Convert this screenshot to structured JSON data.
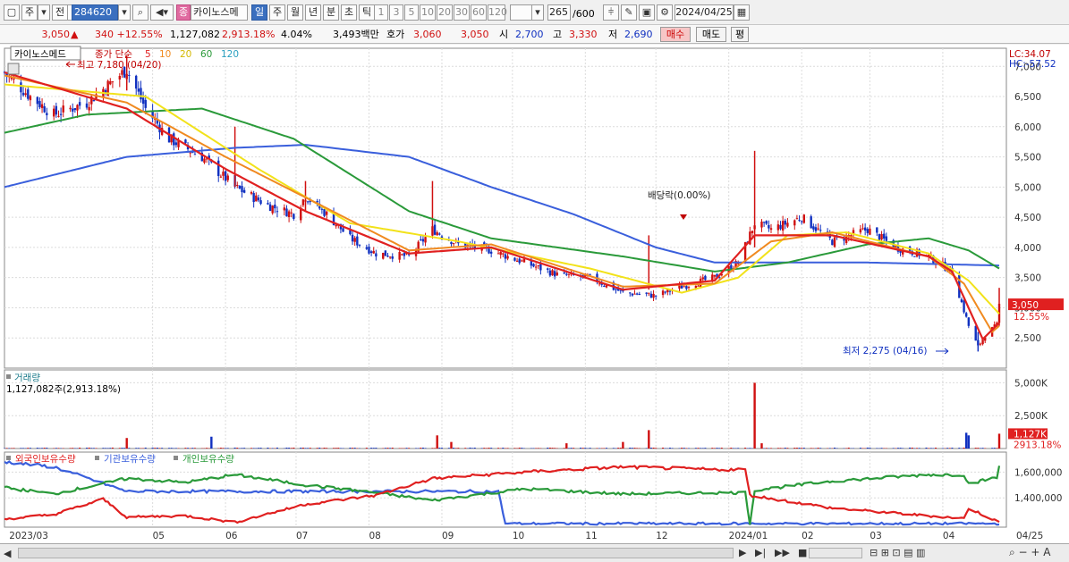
{
  "toolbar": {
    "period_label": "주",
    "prev_label": "전",
    "code": "284620",
    "stock_name": "카이노스메",
    "jong_label": "종",
    "period_tabs": [
      "일",
      "주",
      "월",
      "년",
      "분",
      "초",
      "틱"
    ],
    "active_tab": "일",
    "minute_options": [
      "1",
      "3",
      "5",
      "10",
      "20",
      "30",
      "60",
      "120"
    ],
    "count": "265",
    "count_total": "/600",
    "date": "2024/04/25"
  },
  "quote": {
    "price": "3,050",
    "change": "340 +12.55%",
    "volume": "1,127,082",
    "volume_ratio": "2,913.18%",
    "turnover": "4.04%",
    "amount": "3,493백만",
    "ask_label": "호가",
    "ask1": "3,060",
    "ask2": "3,050",
    "open_label": "시",
    "open": "2,700",
    "high_label": "고",
    "high": "3,330",
    "low_label": "저",
    "low": "2,690",
    "buy_label": "매수",
    "sell_label": "매도",
    "eval_label": "평"
  },
  "colors": {
    "up": "#d01010",
    "down": "#1030c0",
    "ma5": "#e02020",
    "ma10": "#f08a20",
    "ma20": "#f2e21a",
    "ma60": "#2a9a3a",
    "ma120": "#3a5fdc",
    "foreign": "#e02020",
    "institution": "#3a5fdc",
    "individual": "#2a9a3a"
  },
  "chart_data": [
    {
      "type": "candlestick",
      "title": "카이노스메드",
      "legend": {
        "prefix": "종가 단순",
        "periods": [
          "5",
          "10",
          "20",
          "60",
          "120"
        ]
      },
      "ylim": [
        2000,
        7300
      ],
      "yticks": [
        2500,
        3000,
        3500,
        4000,
        4500,
        5000,
        5500,
        6000,
        6500,
        7000
      ],
      "ytick_labels": [
        "2,500",
        "3,000",
        "3,500",
        "4,000",
        "4,500",
        "5,000",
        "5,500",
        "6,000",
        "6,500",
        "7,000"
      ],
      "x_labels": [
        "2023/03",
        "05",
        "06",
        "07",
        "08",
        "09",
        "10",
        "11",
        "12",
        "2024/01",
        "02",
        "03",
        "04",
        "04/25"
      ],
      "x_label_months": [
        "2023-03-01",
        "2023-05-01",
        "2023-06-01",
        "2023-07-01",
        "2023-08-01",
        "2023-09-01",
        "2023-10-01",
        "2023-11-01",
        "2023-12-01",
        "2024-01-01",
        "2024-02-01",
        "2024-03-01",
        "2024-04-01",
        "2024-04-25"
      ],
      "high_annotation": "최고 7,180 (04/20)",
      "low_annotation": "최저 2,275 (04/16)",
      "dividend_annotation": "배당락(0.00%)",
      "lc_label": "LC:34.07",
      "hc_label": "HC:-57.52",
      "current_price": "3,050",
      "current_change": "12.55%",
      "close_keypoints": [
        [
          "2023-02-27",
          6900
        ],
        [
          "2023-03-10",
          6500
        ],
        [
          "2023-03-20",
          6200
        ],
        [
          "2023-04-03",
          6400
        ],
        [
          "2023-04-20",
          6950
        ],
        [
          "2023-04-28",
          6300
        ],
        [
          "2023-05-08",
          5800
        ],
        [
          "2023-05-22",
          5500
        ],
        [
          "2023-06-05",
          5000
        ],
        [
          "2023-06-19",
          4700
        ],
        [
          "2023-06-30",
          4550
        ],
        [
          "2023-07-05",
          4850
        ],
        [
          "2023-07-14",
          4550
        ],
        [
          "2023-07-24",
          4150
        ],
        [
          "2023-08-04",
          3900
        ],
        [
          "2023-08-18",
          3850
        ],
        [
          "2023-08-28",
          4300
        ],
        [
          "2023-09-08",
          4050
        ],
        [
          "2023-09-22",
          3950
        ],
        [
          "2023-10-06",
          3750
        ],
        [
          "2023-10-20",
          3550
        ],
        [
          "2023-11-03",
          3500
        ],
        [
          "2023-11-17",
          3250
        ],
        [
          "2023-12-01",
          3200
        ],
        [
          "2023-12-12",
          3350
        ],
        [
          "2023-12-26",
          3500
        ],
        [
          "2024-01-05",
          3750
        ],
        [
          "2024-01-12",
          4400
        ],
        [
          "2024-01-19",
          4300
        ],
        [
          "2024-02-01",
          4500
        ],
        [
          "2024-02-14",
          4100
        ],
        [
          "2024-02-29",
          4300
        ],
        [
          "2024-03-12",
          4000
        ],
        [
          "2024-03-26",
          3850
        ],
        [
          "2024-04-05",
          3600
        ],
        [
          "2024-04-12",
          2700
        ],
        [
          "2024-04-16",
          2350
        ],
        [
          "2024-04-19",
          2550
        ],
        [
          "2024-04-24",
          2710
        ],
        [
          "2024-04-25",
          3050
        ]
      ],
      "ma_keypoints": {
        "ma5": [
          [
            "2023-02-27",
            6900
          ],
          [
            "2023-04-20",
            6300
          ],
          [
            "2023-06-01",
            5300
          ],
          [
            "2023-07-05",
            4600
          ],
          [
            "2023-08-18",
            3900
          ],
          [
            "2023-09-22",
            4000
          ],
          [
            "2023-11-17",
            3300
          ],
          [
            "2023-12-26",
            3450
          ],
          [
            "2024-01-12",
            4200
          ],
          [
            "2024-02-14",
            4200
          ],
          [
            "2024-03-26",
            3850
          ],
          [
            "2024-04-05",
            3600
          ],
          [
            "2024-04-18",
            2480
          ],
          [
            "2024-04-25",
            2750
          ]
        ],
        "ma10": [
          [
            "2023-02-27",
            6850
          ],
          [
            "2023-04-20",
            6400
          ],
          [
            "2023-06-01",
            5500
          ],
          [
            "2023-07-14",
            4650
          ],
          [
            "2023-08-18",
            3950
          ],
          [
            "2023-09-22",
            4050
          ],
          [
            "2023-11-17",
            3350
          ],
          [
            "2023-12-26",
            3400
          ],
          [
            "2024-01-19",
            4100
          ],
          [
            "2024-02-14",
            4250
          ],
          [
            "2024-03-26",
            3850
          ],
          [
            "2024-04-10",
            3400
          ],
          [
            "2024-04-22",
            2600
          ],
          [
            "2024-04-25",
            2700
          ]
        ],
        "ma20": [
          [
            "2023-02-27",
            6700
          ],
          [
            "2023-04-28",
            6500
          ],
          [
            "2023-06-15",
            5300
          ],
          [
            "2023-07-24",
            4400
          ],
          [
            "2023-09-08",
            4100
          ],
          [
            "2023-11-03",
            3650
          ],
          [
            "2023-12-12",
            3250
          ],
          [
            "2024-01-05",
            3500
          ],
          [
            "2024-01-26",
            4200
          ],
          [
            "2024-02-20",
            4250
          ],
          [
            "2024-03-26",
            3900
          ],
          [
            "2024-04-12",
            3450
          ],
          [
            "2024-04-25",
            2900
          ]
        ],
        "ma60": [
          [
            "2023-02-27",
            5900
          ],
          [
            "2023-04-03",
            6200
          ],
          [
            "2023-05-22",
            6300
          ],
          [
            "2023-06-30",
            5800
          ],
          [
            "2023-08-18",
            4600
          ],
          [
            "2023-09-22",
            4150
          ],
          [
            "2023-11-17",
            3850
          ],
          [
            "2023-12-26",
            3600
          ],
          [
            "2024-01-26",
            3750
          ],
          [
            "2024-02-29",
            4050
          ],
          [
            "2024-03-26",
            4150
          ],
          [
            "2024-04-12",
            3950
          ],
          [
            "2024-04-25",
            3650
          ]
        ],
        "ma120": [
          [
            "2023-02-27",
            5000
          ],
          [
            "2023-04-20",
            5500
          ],
          [
            "2023-06-05",
            5650
          ],
          [
            "2023-07-05",
            5700
          ],
          [
            "2023-08-18",
            5500
          ],
          [
            "2023-09-22",
            5000
          ],
          [
            "2023-10-27",
            4550
          ],
          [
            "2023-12-01",
            4000
          ],
          [
            "2023-12-26",
            3750
          ],
          [
            "2024-01-26",
            3750
          ],
          [
            "2024-02-29",
            3750
          ],
          [
            "2024-04-25",
            3700
          ]
        ]
      }
    },
    {
      "type": "bar",
      "title": "거래량",
      "subtitle": "1,127,082주(2,913.18%)",
      "ylim": [
        0,
        5300
      ],
      "units": "K",
      "yticks": [
        2500,
        5000
      ],
      "ytick_labels": [
        "2,500K",
        "5,000K"
      ],
      "current_label": "1,127K",
      "current_ratio": "2913.18%",
      "base_volume_k": 40,
      "spikes": [
        [
          "2023-04-20",
          800,
          "up"
        ],
        [
          "2023-05-26",
          900,
          "down"
        ],
        [
          "2023-08-30",
          1000,
          "up"
        ],
        [
          "2023-09-05",
          500,
          "up"
        ],
        [
          "2023-10-24",
          400,
          "up"
        ],
        [
          "2023-11-17",
          500,
          "up"
        ],
        [
          "2023-11-28",
          1400,
          "up"
        ],
        [
          "2024-01-12",
          5000,
          "up"
        ],
        [
          "2024-01-15",
          400,
          "up"
        ],
        [
          "2024-04-11",
          1200,
          "down"
        ],
        [
          "2024-04-12",
          1000,
          "down"
        ],
        [
          "2024-04-25",
          1127,
          "up"
        ]
      ]
    },
    {
      "type": "line",
      "series_labels": [
        "외국인보유수량",
        "기관보유수량",
        "개인보유수량"
      ],
      "ylim": [
        1200000,
        1700000
      ],
      "yticks": [
        1400000,
        1600000
      ],
      "ytick_labels": [
        "1,400,000",
        "1,600,000"
      ],
      "foreign_keypoints": [
        [
          "2023-02-27",
          1235000
        ],
        [
          "2023-03-20",
          1270000
        ],
        [
          "2023-04-10",
          1390000
        ],
        [
          "2023-04-20",
          1250000
        ],
        [
          "2023-05-15",
          1260000
        ],
        [
          "2023-06-05",
          1210000
        ],
        [
          "2023-07-05",
          1350000
        ],
        [
          "2023-08-04",
          1420000
        ],
        [
          "2023-08-28",
          1550000
        ],
        [
          "2023-10-06",
          1600000
        ],
        [
          "2023-11-17",
          1640000
        ],
        [
          "2023-12-26",
          1620000
        ],
        [
          "2024-01-08",
          1620000
        ],
        [
          "2024-01-10",
          1420000
        ],
        [
          "2024-02-14",
          1320000
        ],
        [
          "2024-03-26",
          1260000
        ],
        [
          "2024-04-10",
          1240000
        ],
        [
          "2024-04-12",
          1320000
        ],
        [
          "2024-04-25",
          1210000
        ]
      ],
      "institution_keypoints": [
        [
          "2023-02-27",
          1680000
        ],
        [
          "2023-03-20",
          1640000
        ],
        [
          "2023-04-20",
          1450000
        ],
        [
          "2023-05-15",
          1450000
        ],
        [
          "2023-09-25",
          1450000
        ],
        [
          "2023-09-28",
          1200000
        ],
        [
          "2024-04-25",
          1200000
        ]
      ],
      "individual_keypoints": [
        [
          "2023-02-27",
          1480000
        ],
        [
          "2023-03-20",
          1430000
        ],
        [
          "2023-04-20",
          1550000
        ],
        [
          "2023-05-15",
          1520000
        ],
        [
          "2023-06-05",
          1580000
        ],
        [
          "2023-07-05",
          1500000
        ],
        [
          "2023-08-04",
          1440000
        ],
        [
          "2023-08-28",
          1380000
        ],
        [
          "2023-10-06",
          1470000
        ],
        [
          "2023-11-17",
          1430000
        ],
        [
          "2023-12-26",
          1440000
        ],
        [
          "2024-01-08",
          1440000
        ],
        [
          "2024-01-10",
          1200000
        ],
        [
          "2024-01-12",
          1460000
        ],
        [
          "2024-02-14",
          1530000
        ],
        [
          "2024-03-26",
          1580000
        ],
        [
          "2024-04-10",
          1580000
        ],
        [
          "2024-04-12",
          1510000
        ],
        [
          "2024-04-24",
          1560000
        ],
        [
          "2024-04-25",
          1640000
        ]
      ]
    }
  ]
}
